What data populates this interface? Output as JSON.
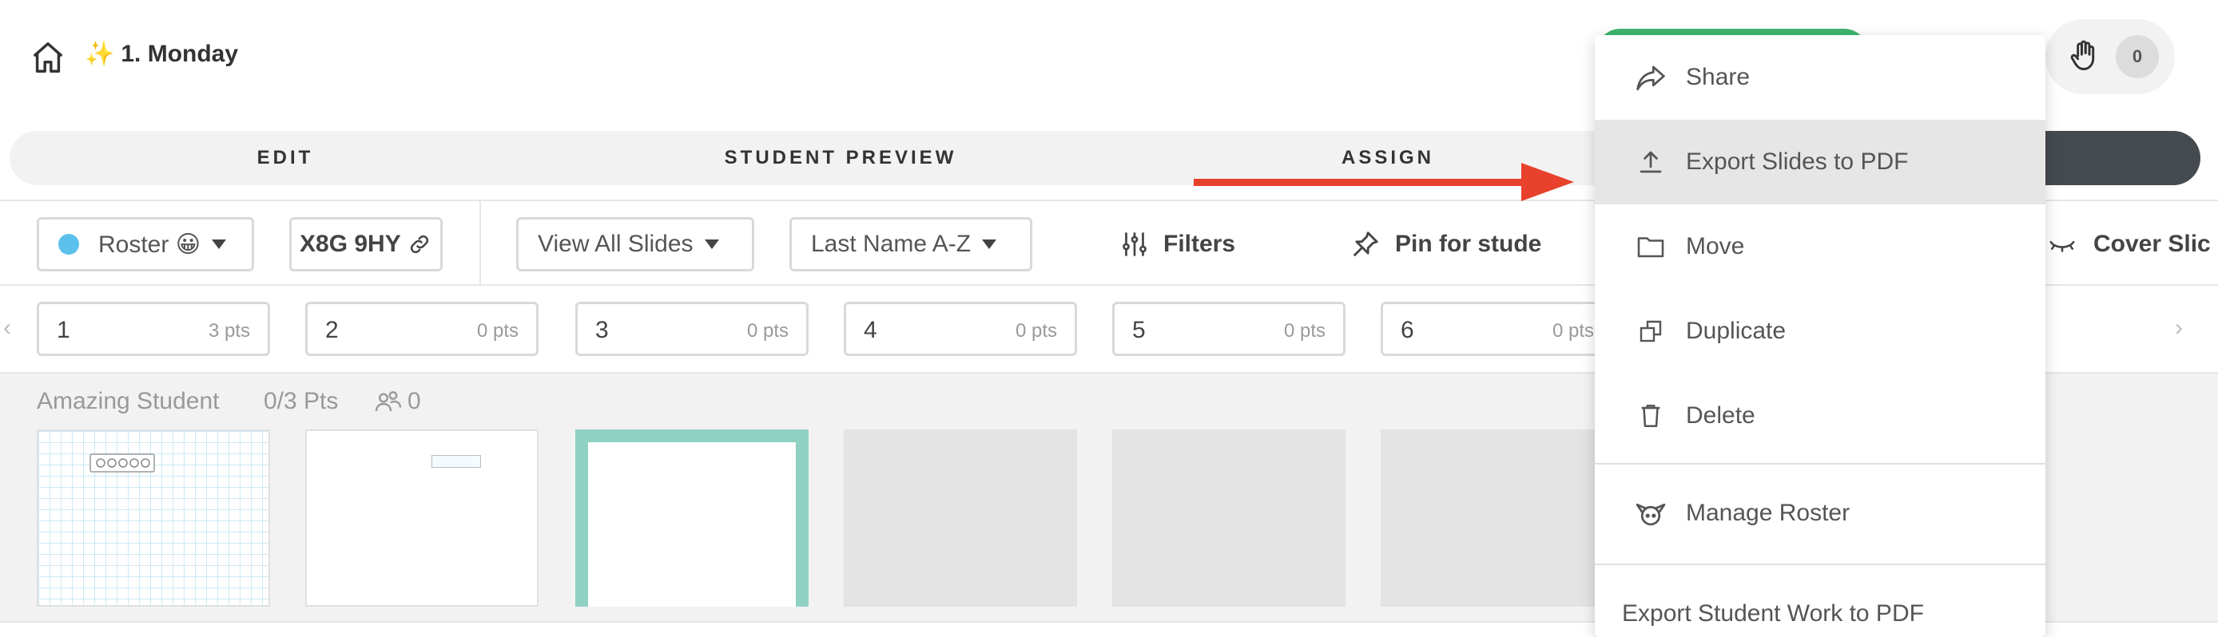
{
  "header": {
    "sparkle": "✨",
    "title": "1. Monday",
    "hand_count": "0"
  },
  "tabs": {
    "edit": "EDIT",
    "preview": "STUDENT PREVIEW",
    "assign": "ASSIGN"
  },
  "toolbar": {
    "roster_label": "Roster 😀",
    "class_code": "X8G 9HY",
    "view_label": "View All Slides",
    "sort_label": "Last Name A-Z",
    "filters_label": "Filters",
    "pin_label": "Pin for stude",
    "cover_label": "Cover Slic"
  },
  "slides": [
    {
      "num": "1",
      "pts": "3 pts"
    },
    {
      "num": "2",
      "pts": "0 pts"
    },
    {
      "num": "3",
      "pts": "0 pts"
    },
    {
      "num": "4",
      "pts": "0 pts"
    },
    {
      "num": "5",
      "pts": "0 pts"
    },
    {
      "num": "6",
      "pts": "0 pts"
    }
  ],
  "strip_nav": {
    "left": "‹",
    "right": "›"
  },
  "student": {
    "name": "Amazing Student",
    "points": "0/3 Pts",
    "group_count": "0"
  },
  "menu": {
    "share": "Share",
    "export_slides": "Export Slides to PDF",
    "move": "Move",
    "duplicate": "Duplicate",
    "delete": "Delete",
    "manage_roster": "Manage Roster",
    "export_work": "Export Student Work to PDF"
  },
  "colors": {
    "accent_green": "#3fb56f",
    "roster_dot": "#5bc0eb",
    "arrow_red": "#e8412c",
    "dark_tab": "#454a4f",
    "thumb_teal": "#8fd1c3"
  }
}
